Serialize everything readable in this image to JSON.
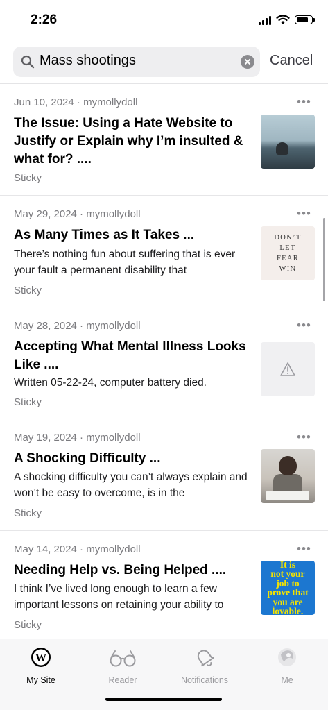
{
  "status_bar": {
    "time": "2:26",
    "battery_level": 0.85
  },
  "search": {
    "query": "Mass shootings",
    "cancel_label": "Cancel"
  },
  "posts": [
    {
      "meta": "Jun 10, 2024 · mymollydoll",
      "title": "The Issue: Using a Hate Website to Justify or Explain why I’m insulted & what for? ....",
      "excerpt": "",
      "tag": "Sticky",
      "thumbnail": "sea-photo"
    },
    {
      "meta": "May 29, 2024 · mymollydoll",
      "title": "As Many Times as It Takes ...",
      "excerpt": "There’s nothing fun about suffering that is ever your fault a permanent disability that",
      "tag": "Sticky",
      "thumbnail": "text-poster",
      "thumbnail_text": [
        "DON’T",
        "LET",
        "FEAR",
        "WIN"
      ]
    },
    {
      "meta": "May 28, 2024 · mymollydoll",
      "title": "Accepting What Mental Illness Looks Like ....",
      "excerpt": "Written 05-22-24, computer battery died.",
      "tag": "Sticky",
      "thumbnail": "warning-icon"
    },
    {
      "meta": "May 19, 2024 · mymollydoll",
      "title": "A Shocking Difficulty ...",
      "excerpt": "A shocking difficulty you can’t always explain and won’t be easy to overcome, is in the",
      "tag": "Sticky",
      "thumbnail": "stressed-student-photo"
    },
    {
      "meta": "May 14, 2024 · mymollydoll",
      "title": "Needing Help vs. Being Helped ....",
      "excerpt": "I think I’ve lived long enough to learn a few important lessons on retaining your ability to",
      "tag": "Sticky",
      "thumbnail": "quote-poster",
      "thumbnail_text": [
        "It is",
        "not your",
        "job to",
        "prove that",
        "you are",
        "lovable."
      ]
    }
  ],
  "tab_bar": {
    "tabs": [
      {
        "label": "My Site",
        "icon": "wordpress-icon",
        "active": true
      },
      {
        "label": "Reader",
        "icon": "glasses-icon",
        "active": false
      },
      {
        "label": "Notifications",
        "icon": "bell-icon",
        "active": false
      },
      {
        "label": "Me",
        "icon": "avatar",
        "active": false
      }
    ]
  },
  "colors": {
    "accent": "#000000",
    "inactive_tab": "#9b9b9f",
    "quote_bg": "#1c77d0",
    "quote_text": "#f4e300"
  }
}
